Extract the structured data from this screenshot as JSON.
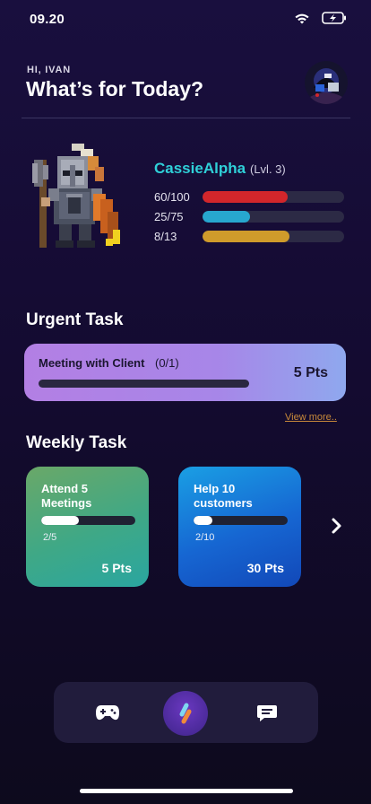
{
  "status_bar": {
    "time": "09.20"
  },
  "header": {
    "greeting": "HI, IVAN",
    "headline": "What’s for Today?"
  },
  "character": {
    "name": "CassieAlpha",
    "level": "(Lvl. 3)",
    "stats": [
      {
        "label": "60/100",
        "current": 60,
        "max": 100,
        "color": "#d2262b"
      },
      {
        "label": "25/75",
        "current": 25,
        "max": 75,
        "color": "#27a7cf"
      },
      {
        "label": "8/13",
        "current": 8,
        "max": 13,
        "color": "#cf9b2b"
      }
    ]
  },
  "urgent": {
    "section_title": "Urgent Task",
    "task_name": "Meeting with Client",
    "progress_text": "(0/1)",
    "progress": 0,
    "points": "5 Pts",
    "view_more": "View more.."
  },
  "weekly": {
    "section_title": "Weekly Task",
    "cards": [
      {
        "title": "Attend 5 Meetings",
        "progress_text": "2/5",
        "progress": 0.4,
        "points": "5 Pts"
      },
      {
        "title": "Help 10 customers",
        "progress_text": "2/10",
        "progress": 0.2,
        "points": "30 Pts"
      }
    ]
  },
  "icons": {
    "wifi": "wifi-icon",
    "battery": "battery-charging-icon",
    "avatar": "profile-avatar",
    "next": "chevron-right-icon",
    "game": "gamepad-icon",
    "home": "app-logo-icon",
    "chat": "chat-icon"
  }
}
